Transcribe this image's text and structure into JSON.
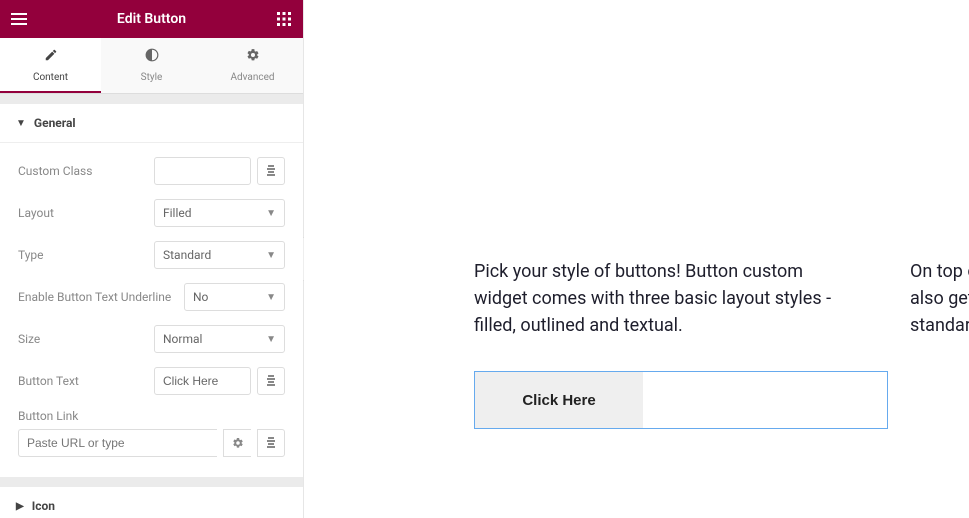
{
  "header": {
    "title": "Edit Button"
  },
  "tabs": [
    {
      "label": "Content",
      "icon": "pencil"
    },
    {
      "label": "Style",
      "icon": "contrast"
    },
    {
      "label": "Advanced",
      "icon": "gear"
    }
  ],
  "sections": {
    "general": {
      "title": "General",
      "fields": {
        "custom_class": {
          "label": "Custom Class",
          "value": ""
        },
        "layout": {
          "label": "Layout",
          "value": "Filled"
        },
        "type": {
          "label": "Type",
          "value": "Standard"
        },
        "underline": {
          "label": "Enable Button Text Underline",
          "value": "No"
        },
        "size": {
          "label": "Size",
          "value": "Normal"
        },
        "button_text": {
          "label": "Button Text",
          "value": "Click Here"
        },
        "button_link": {
          "label": "Button Link",
          "placeholder": "Paste URL or type"
        }
      }
    },
    "icon": {
      "title": "Icon"
    }
  },
  "preview": {
    "paragraph": "Pick your style of buttons! Button custom widget comes with three basic layout styles - filled, outlined and textual.",
    "paragraph_right_1": "On top o",
    "paragraph_right_2": "also get",
    "paragraph_right_3": "standard",
    "button_label": "Click Here"
  }
}
